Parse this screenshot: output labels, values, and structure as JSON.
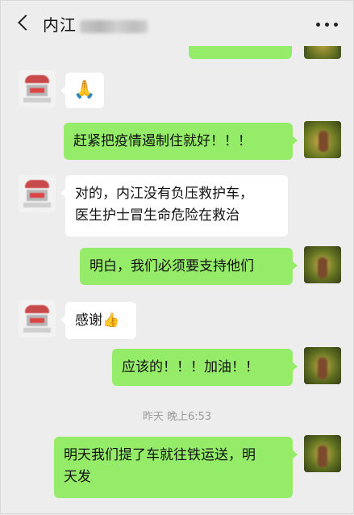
{
  "header": {
    "title": "内江",
    "back_icon": "chevron-left-icon",
    "more_icon": "more-dots-icon"
  },
  "messages": [
    {
      "side": "out",
      "text": ""
    },
    {
      "side": "in",
      "text": "🙏"
    },
    {
      "side": "out",
      "text": "赶紧把疫情遏制住就好！！！"
    },
    {
      "side": "in",
      "line1": "对的，内江没有负压救护车，",
      "line2": "医生护士冒生命危险在救治"
    },
    {
      "side": "out",
      "text": "明白，我们必须要支持他们"
    },
    {
      "side": "in",
      "text": "感谢👍"
    },
    {
      "side": "out",
      "text": "应该的！！！加油！！"
    },
    {
      "side": "out",
      "line1": "明天我们提了车就往铁运送，明",
      "line2": "天发"
    }
  ],
  "timestamp": "昨天 晚上6:53",
  "colors": {
    "out_bubble": "#95ec69",
    "in_bubble": "#ffffff",
    "background": "#ededed"
  }
}
